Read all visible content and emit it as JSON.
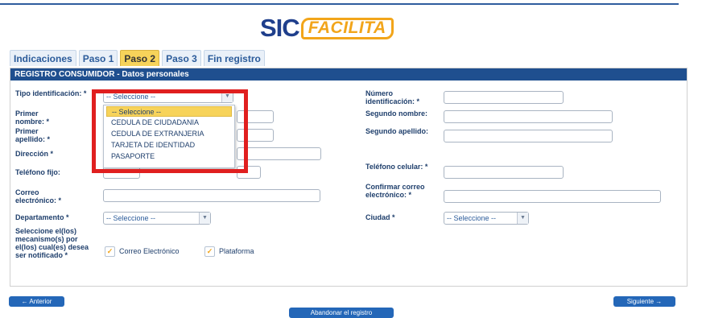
{
  "logo": {
    "sic": "SIC",
    "facilita": "FACILITA"
  },
  "tabs": [
    "Indicaciones",
    "Paso 1",
    "Paso 2",
    "Paso 3",
    "Fin registro"
  ],
  "panel": {
    "title": "REGISTRO CONSUMIDOR - Datos personales"
  },
  "labels": {
    "tipo": "Tipo identificación: *",
    "primer_nombre": "Primer nombre: *",
    "primer_apellido": "Primer apellido: *",
    "direccion": "Dirección *",
    "telefono_fijo": "Teléfono fijo:",
    "correo": "Correo electrónico: *",
    "departamento": "Departamento *",
    "mecanismos": "Seleccione el(los) mecanismo(s) por el(los) cual(es) desea ser notificado *",
    "numero_id": "Número identificación: *",
    "segundo_nombre": "Segundo nombre:",
    "segundo_apellido": "Segundo apellido:",
    "telefono_celular": "Teléfono celular: *",
    "confirmar_correo": "Confirmar correo electrónico: *",
    "ciudad": "Ciudad *"
  },
  "selects": {
    "tipo": "-- Seleccione --",
    "departamento": "-- Seleccione --",
    "ciudad": "-- Seleccione --"
  },
  "dropdown": {
    "options": [
      "-- Seleccione --",
      "CEDULA DE CIUDADANIA",
      "CEDULA DE EXTRANJERIA",
      "TARJETA DE IDENTIDAD",
      "PASAPORTE"
    ]
  },
  "checkboxes": [
    {
      "label": "Correo Electrónico",
      "checked": true
    },
    {
      "label": "Plataforma",
      "checked": true
    }
  ],
  "buttons": {
    "anterior": "← Anterior",
    "siguiente": "Siguiente →",
    "abandonar": "Abandonar el registro"
  },
  "colors": {
    "accent": "#f2a51a",
    "primary": "#1f4f8f",
    "highlight": "#e01f1f"
  }
}
